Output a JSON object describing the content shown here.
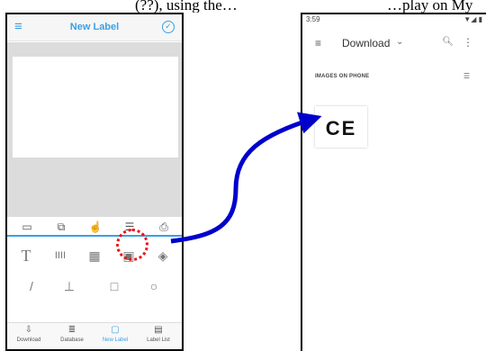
{
  "caption": {
    "left_text": "(??), using the…",
    "right_text": "…play on My"
  },
  "left_phone": {
    "title": "New Label",
    "tools_top": [
      "tab-icon",
      "layers-icon",
      "touch-icon",
      "align-icon",
      "print-icon"
    ],
    "palette": {
      "text_glyph": "T",
      "barcode_glyph": "IIII",
      "qr_glyph": "▦",
      "image_glyph": "▣",
      "camera_glyph": "◈"
    },
    "lines": {
      "diagonal": "/",
      "tee": "⊥",
      "square": "□",
      "circle": "○"
    },
    "bottom_nav": [
      {
        "label": "Download",
        "icon": "⇩",
        "active": false
      },
      {
        "label": "Database",
        "icon": "≣",
        "active": false
      },
      {
        "label": "New Label",
        "icon": "▢",
        "active": true
      },
      {
        "label": "Label List",
        "icon": "▤",
        "active": false
      }
    ],
    "highlight_color": "#ee1111",
    "accent_color": "#3aa0e6"
  },
  "right_phone": {
    "status_time": "3:59",
    "status_icons": "▼◢ ▮",
    "title": "Download",
    "section": "IMAGES ON PHONE",
    "thumb_text": "CE"
  },
  "arrow_color": "#0000cc"
}
